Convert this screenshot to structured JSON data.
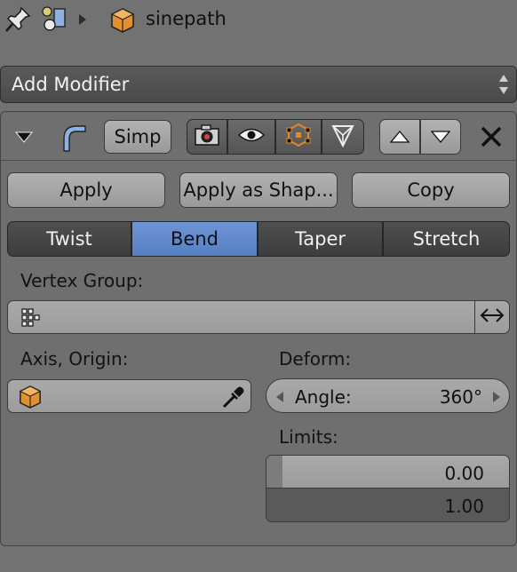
{
  "header": {
    "object_name": "sinepath",
    "icons": [
      "pin-icon",
      "scene-data-icon",
      "breadcrumb-arrow-icon",
      "object-cube-icon"
    ]
  },
  "add_modifier": {
    "label": "Add Modifier"
  },
  "modifier": {
    "name": "Simp",
    "icons": [
      "collapse-triangle-icon",
      "modifier-bend-icon",
      "render-camera-icon",
      "viewport-eye-icon",
      "editmode-icon",
      "cage-icon",
      "move-up-icon",
      "move-down-icon",
      "remove-x-icon"
    ],
    "actions": {
      "apply": "Apply",
      "apply_shape": "Apply as Shap...",
      "copy": "Copy"
    },
    "modes": [
      "Twist",
      "Bend",
      "Taper",
      "Stretch"
    ],
    "active_mode": "Bend",
    "vertex_group": {
      "label": "Vertex Group:",
      "value": ""
    },
    "axis_origin": {
      "label": "Axis, Origin:",
      "value": ""
    },
    "deform": {
      "label": "Deform:",
      "angle_label": "Angle:",
      "angle_value": "360°"
    },
    "limits": {
      "label": "Limits:",
      "min": "0.00",
      "max": "1.00",
      "min_fill": 0.0
    }
  },
  "colors": {
    "accent": "#5a84c8",
    "panel": "#727272",
    "orange": "#e08a2a"
  }
}
